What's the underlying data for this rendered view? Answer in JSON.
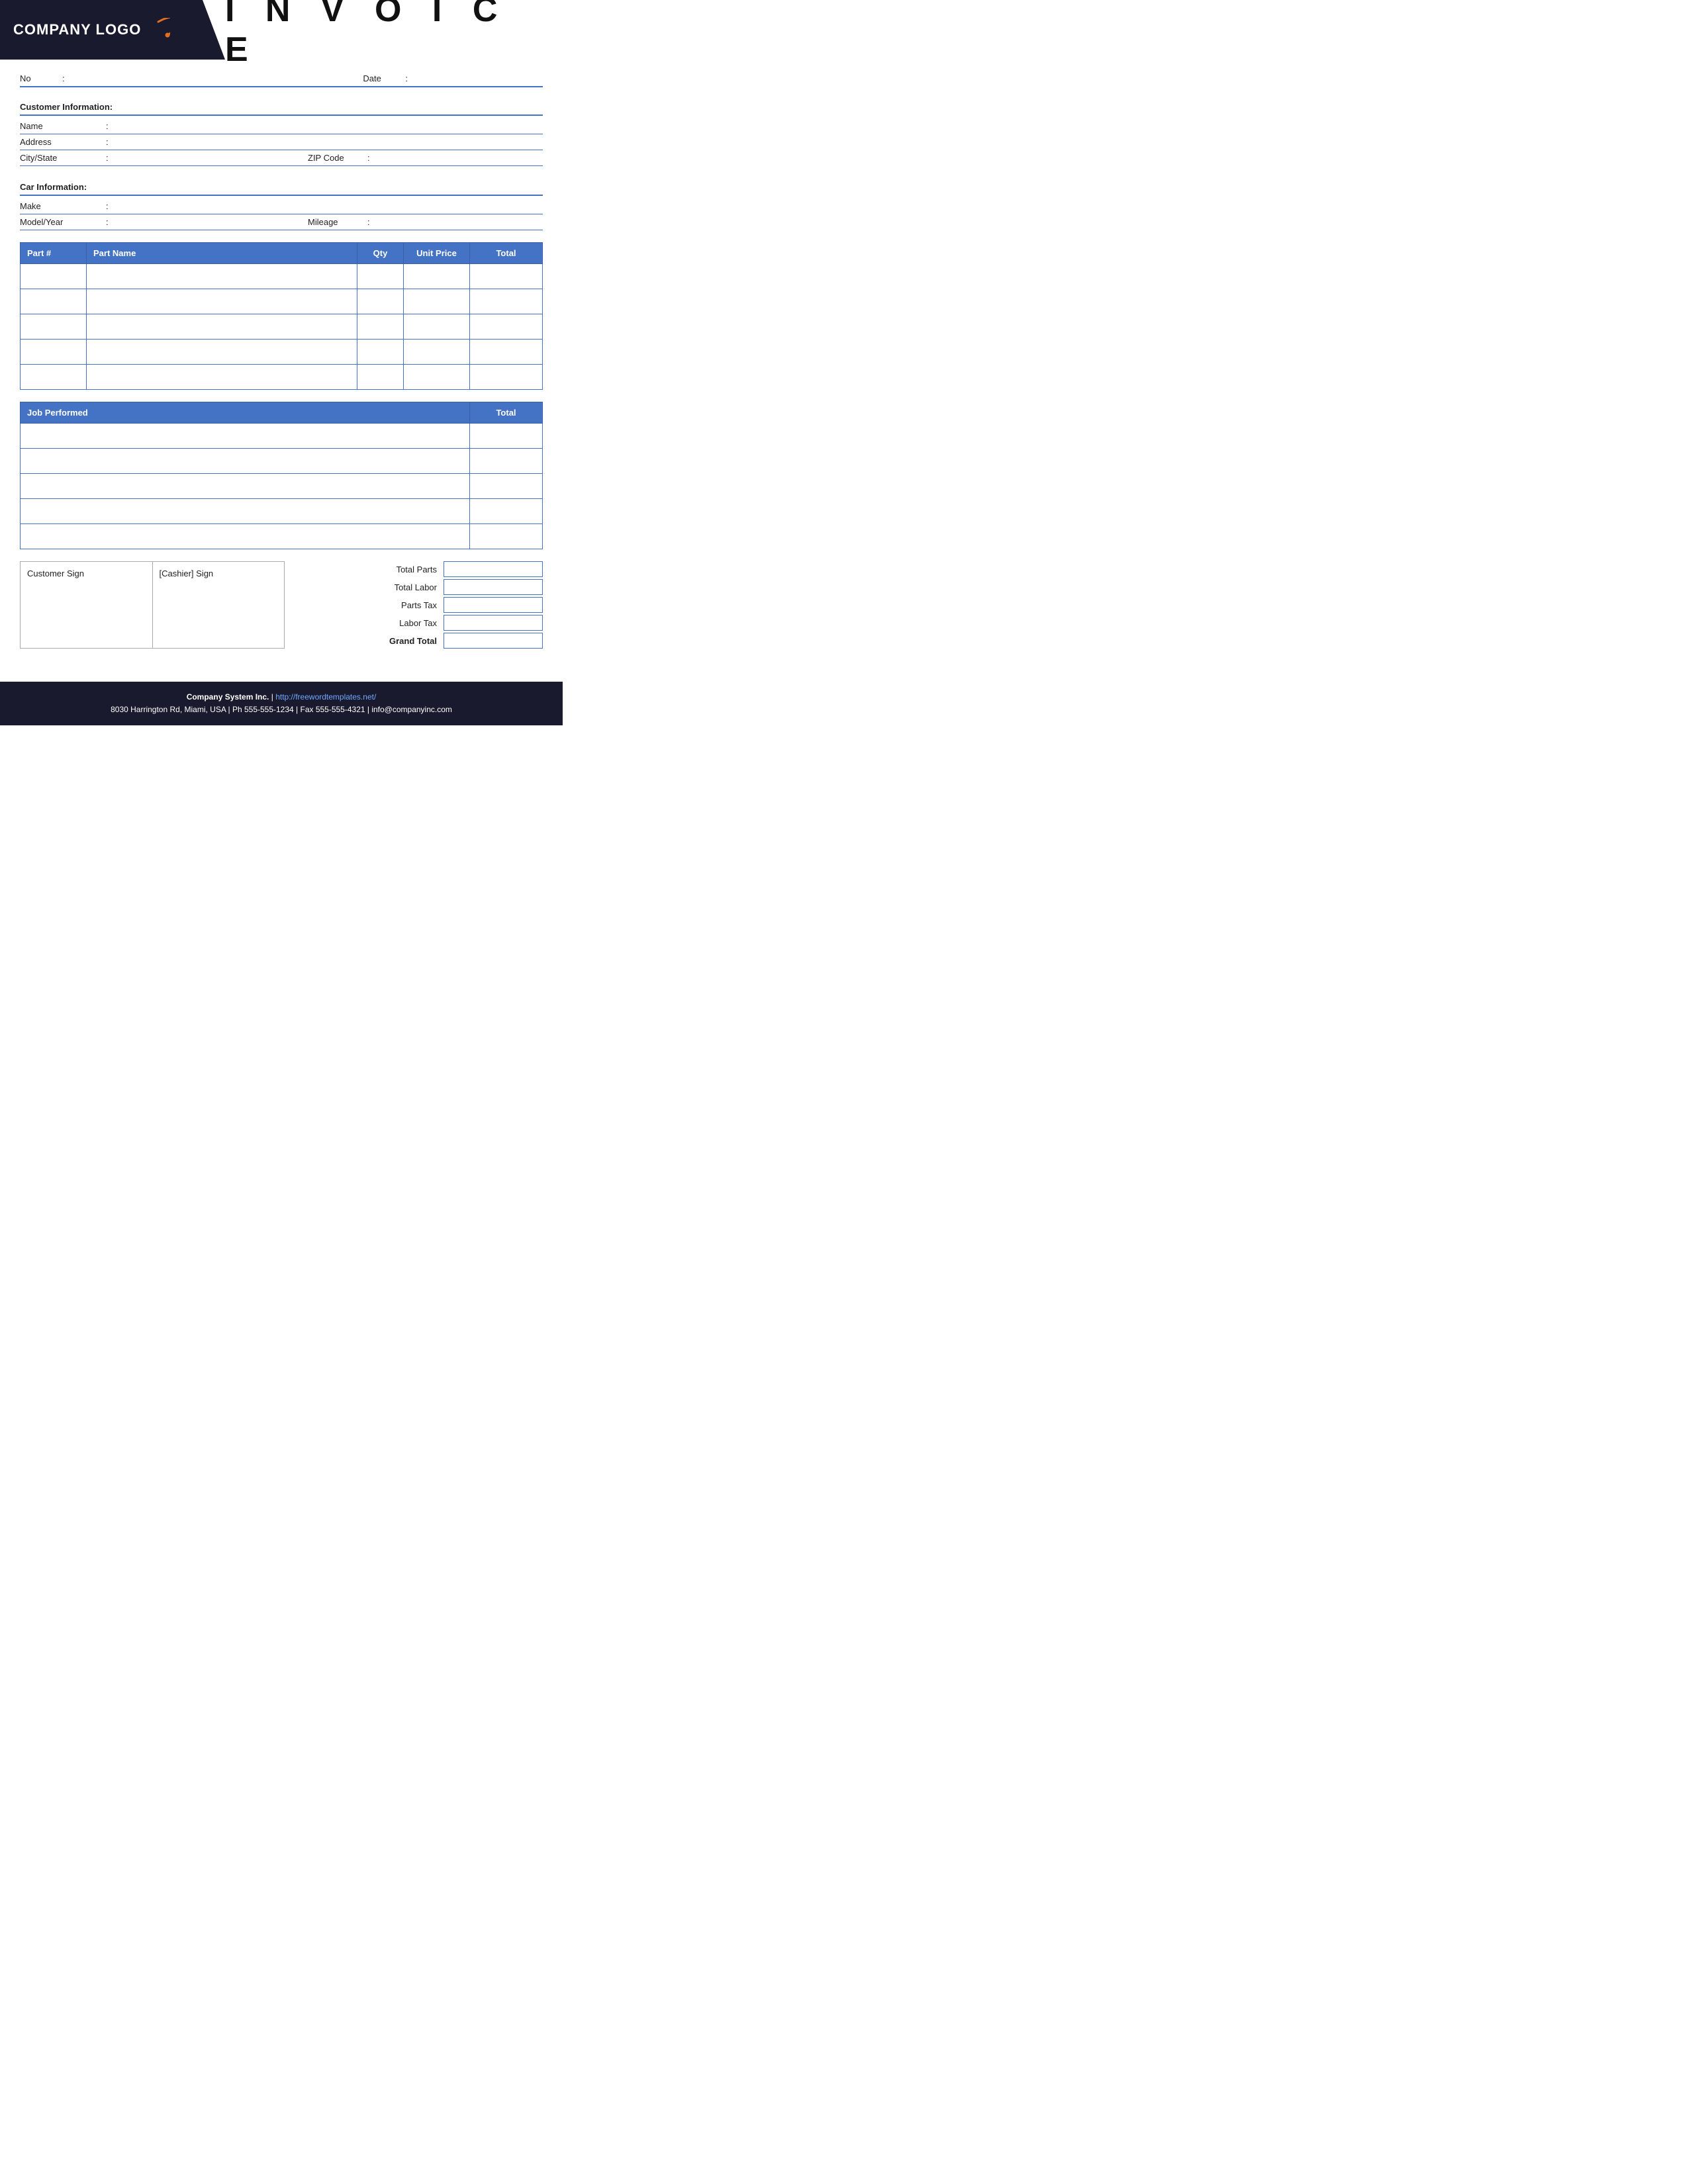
{
  "header": {
    "logo_text": "COMPANY LOGO",
    "invoice_title": "I N V O I C E"
  },
  "invoice_fields": {
    "no_label": "No",
    "no_colon": ":",
    "date_label": "Date",
    "date_colon": ":"
  },
  "customer_info": {
    "section_label": "Customer Information:",
    "name_label": "Name",
    "name_colon": ":",
    "address_label": "Address",
    "address_colon": ":",
    "city_state_label": "City/State",
    "city_state_colon": ":",
    "zip_code_label": "ZIP Code",
    "zip_code_colon": ":"
  },
  "car_info": {
    "section_label": "Car Information:",
    "make_label": "Make",
    "make_colon": ":",
    "model_year_label": "Model/Year",
    "model_year_colon": ":",
    "mileage_label": "Mileage",
    "mileage_colon": ":"
  },
  "parts_table": {
    "col_partnum": "Part #",
    "col_partname": "Part Name",
    "col_qty": "Qty",
    "col_unitprice": "Unit Price",
    "col_total": "Total",
    "rows": [
      {},
      {},
      {},
      {},
      {}
    ]
  },
  "jobs_table": {
    "col_job": "Job Performed",
    "col_total": "Total",
    "rows": [
      {},
      {},
      {},
      {},
      {}
    ]
  },
  "signatures": {
    "customer_sign": "Customer Sign",
    "cashier_sign": "[Cashier] Sign"
  },
  "totals": {
    "total_parts_label": "Total Parts",
    "total_labor_label": "Total Labor",
    "parts_tax_label": "Parts Tax",
    "labor_tax_label": "Labor Tax",
    "grand_total_label": "Grand Total"
  },
  "footer": {
    "company_name": "Company System Inc.",
    "pipe": "|",
    "website": "http://freewordtemplates.net/",
    "address_line": "8030 Harrington Rd, Miami, USA | Ph 555-555-1234 | Fax 555-555-4321 | info@companyinc.com"
  }
}
